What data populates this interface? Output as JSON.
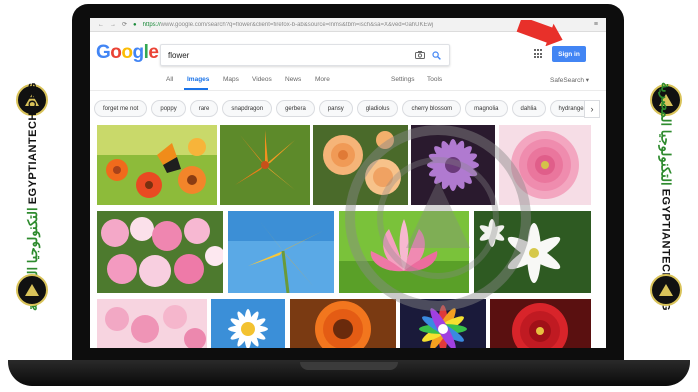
{
  "browser": {
    "url_prefix": "https://",
    "url": "www.google.com/search?q=flower&client=firefox-b-ab&source=lnms&tbm=isch&sa=X&ved=0ahUKEwj"
  },
  "google": {
    "logo": [
      "G",
      "o",
      "o",
      "g",
      "l",
      "e"
    ],
    "search_query": "flower",
    "signin_label": "Sign in"
  },
  "tabs": {
    "all": "All",
    "images": "Images",
    "maps": "Maps",
    "videos": "Videos",
    "news": "News",
    "more": "More",
    "settings": "Settings",
    "tools": "Tools",
    "safesearch": "SafeSearch ▾",
    "active": "Images"
  },
  "chips": [
    "forget me not",
    "poppy",
    "rare",
    "snapdragon",
    "gerbera",
    "pansy",
    "gladiolus",
    "cherry blossom",
    "magnolia",
    "dahlia",
    "hydrangea"
  ],
  "side_branding": {
    "arabic": "التكنولوجيا المصرية",
    "latin": "EGYPTIANTECH.ORG"
  },
  "colors": {
    "google_blue": "#4285f4",
    "google_red": "#ea4335",
    "google_yellow": "#fbbc05",
    "google_green": "#34a853",
    "active_tab": "#1a73e8",
    "brand_gold": "#d9c35a",
    "brand_green": "#2e8b2e"
  },
  "icons": [
    "camera-icon",
    "search-icon",
    "apps-icon",
    "chevron-right-icon",
    "back-icon",
    "reload-icon"
  ],
  "image_results": [
    "orange-flowers-butterfly",
    "orange-lily",
    "peach-roses",
    "purple-daisy",
    "pink-dahlia",
    "pink-roses-bouquet",
    "yellow-flower-blue-sky",
    "pink-lotus",
    "white-clematis",
    "cherry-blossom",
    "white-daisies",
    "orange-gerbera",
    "rainbow-flower",
    "red-dahlia"
  ]
}
